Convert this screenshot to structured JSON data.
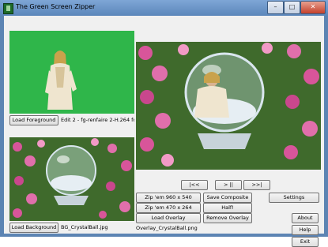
{
  "window": {
    "title": "The Green Screen Zipper",
    "minimize": "–",
    "maximize": "□",
    "close": "✕"
  },
  "foreground": {
    "button": "Load Foreground",
    "caption": "Edit 2 - fg-renfaire 2-H.264 for A"
  },
  "background": {
    "button": "Load Background",
    "caption": "BG_CrystalBall.jpg"
  },
  "playback": {
    "rewind": "|<<",
    "play_pause": "> ||",
    "forward": ">>|"
  },
  "actions": {
    "zip_960": "Zip 'em 960 x 540",
    "zip_470": "Zip 'em 470 x 264",
    "load_overlay": "Load Overlay",
    "save_composite": "Save Composite",
    "half": "Half!",
    "remove_overlay": "Remove Overlay",
    "overlay_caption": "Overlay_CrystalBall.png"
  },
  "side": {
    "settings": "Settings",
    "about": "About",
    "help": "Help",
    "exit": "Exit"
  },
  "colors": {
    "green_screen": "#2fb64a",
    "window_frame": "#5c84b3",
    "flower_pink": "#d8559a",
    "foliage": "#3f6a2c"
  }
}
